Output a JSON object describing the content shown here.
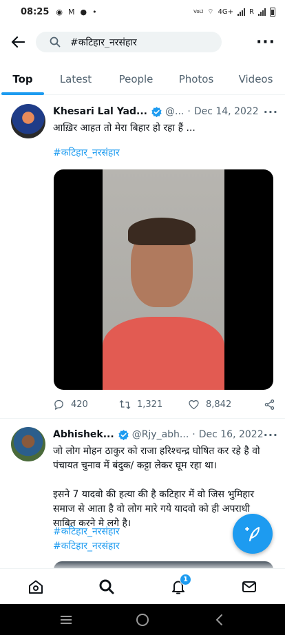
{
  "status_bar": {
    "time": "08:25",
    "network": "4G+",
    "roaming": "R",
    "volte": "VoLTE"
  },
  "search": {
    "query": "#कटिहार_नरसंहार"
  },
  "tabs": [
    {
      "label": "Top",
      "active": true
    },
    {
      "label": "Latest",
      "active": false
    },
    {
      "label": "People",
      "active": false
    },
    {
      "label": "Photos",
      "active": false
    },
    {
      "label": "Videos",
      "active": false
    }
  ],
  "tweets": [
    {
      "name": "Khesari Lal Yad...",
      "handle": "@...",
      "date": "Dec 14, 2022",
      "text": "आख़िर आहत तो मेरा बिहार हो रहा हैं ...",
      "hashtag": "#कटिहार_नरसंहार",
      "reply_count": "420",
      "retweet_count": "1,321",
      "like_count": "8,842"
    },
    {
      "name": "Abhishek...",
      "handle": "@Rjy_abh...",
      "date": "Dec 16, 2022",
      "text_1": "जो लोग मोहन ठाकुर को राजा हरिश्चन्द्र घोषित कर रहे है वो पंचायत चुनाव में बंदुक/ कट्टा लेकर घूम रहा था।",
      "text_2": "इसने 7 यादवो की हत्या की है कटिहार में वो जिस भुमिहार समाज से आता है वो लोग मारे गये यादवो को ही अपराधी साबित करने मे लगे है।",
      "hashtag_1": "#कटिहार_नरसंहार",
      "hashtag_2": "#कटिहार_नरसंहार"
    }
  ],
  "bottom_nav": {
    "notifications_badge": "1"
  },
  "colors": {
    "accent": "#1d9bf0",
    "text_primary": "#0f1419",
    "text_secondary": "#536471"
  }
}
